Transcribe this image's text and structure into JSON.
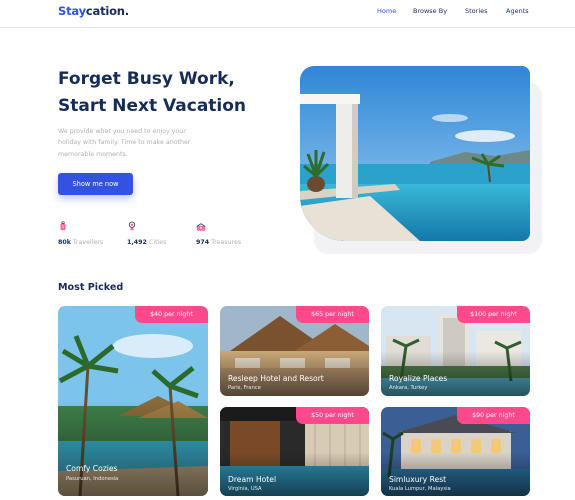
{
  "brand": {
    "prefix": "Stay",
    "suffix": "cation."
  },
  "nav": {
    "items": [
      "Home",
      "Browse By",
      "Stories",
      "Agents"
    ],
    "active": "Home"
  },
  "hero": {
    "title_line1": "Forget Busy Work,",
    "title_line2": "Start Next Vacation",
    "description_lines": [
      "We provide what you need to enjoy your",
      "holiday with family. Time to make another",
      "memorable moments."
    ],
    "cta_label": "Show me now"
  },
  "stats": [
    {
      "icon": "traveler-icon",
      "value": "80k",
      "label": "Travellers"
    },
    {
      "icon": "camera-icon",
      "value": "1,492",
      "label": "Cities"
    },
    {
      "icon": "treasure-icon",
      "value": "974",
      "label": "Treasures"
    }
  ],
  "most_picked": {
    "title": "Most Picked",
    "cards": [
      {
        "price": "$40 per night",
        "name": "Comfy Cozies",
        "location": "Pasuruan, Indonesia"
      },
      {
        "price": "$65 per night",
        "name": "Resleep Hotel and Resort",
        "location": "Paris, France"
      },
      {
        "price": "$100 per night",
        "name": "Royalize Places",
        "location": "Ankara, Turkey"
      },
      {
        "price": "$50 per night",
        "name": "Dream Hotel",
        "location": "Virginia, USA"
      },
      {
        "price": "$90 per night",
        "name": "Simluxury Rest",
        "location": "Kuala Lumpur, Malaysia"
      }
    ]
  },
  "colors": {
    "primary": "#3252df",
    "dark": "#152c5b",
    "accent": "#ff498b",
    "muted": "#b0b0b0"
  }
}
